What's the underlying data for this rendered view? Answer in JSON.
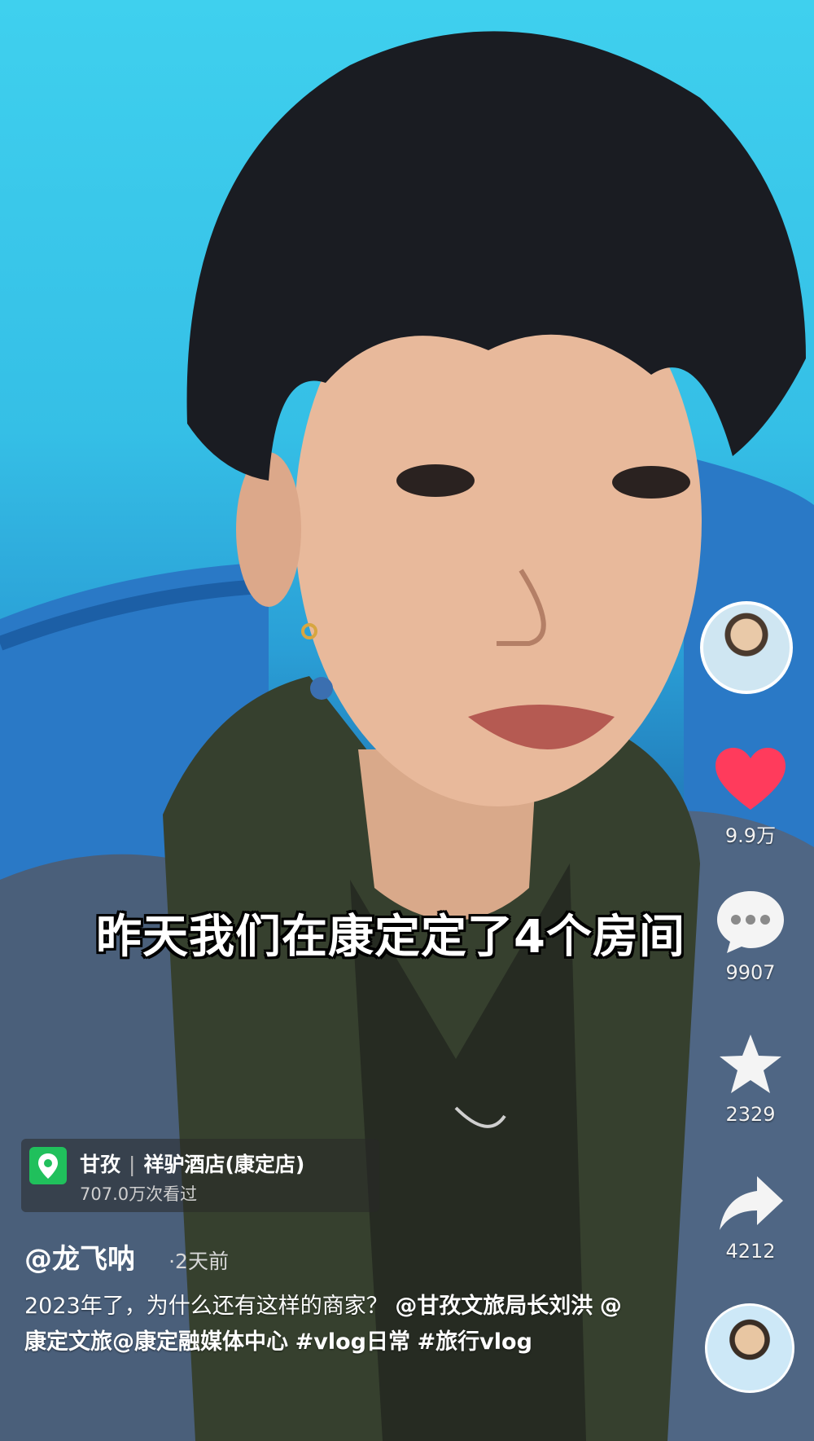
{
  "video": {
    "subtitle": "昨天我们在康定定了4个房间"
  },
  "side_actions": {
    "likes": "9.9万",
    "comments": "9907",
    "favorites": "2329",
    "shares": "4212"
  },
  "location": {
    "region": "甘孜",
    "place": "祥驴酒店(康定店)",
    "views": "707.0万次看过"
  },
  "post": {
    "author": "@龙飞呐",
    "time": "·2天前",
    "description_text": "2023年了，为什么还有这样的商家？",
    "mention_1": "@甘孜文旅局长刘洪",
    "mention_2": "@康定文旅",
    "mention_3": "@康定融媒体中心",
    "tag_1": "#vlog日常",
    "tag_2": "#旅行vlog"
  },
  "colors": {
    "like_red": "#ff3b5c",
    "location_green": "#20c05c"
  }
}
